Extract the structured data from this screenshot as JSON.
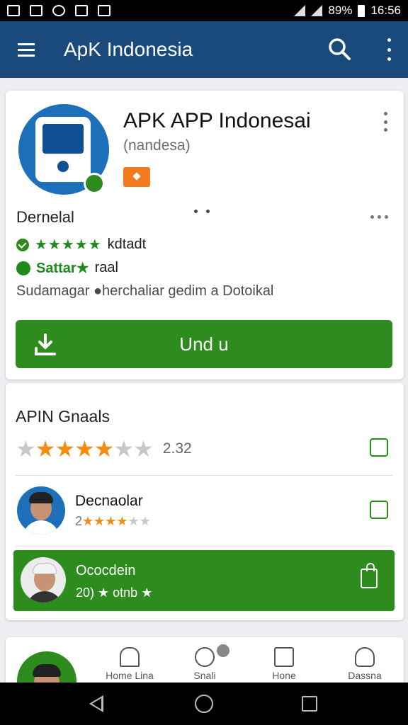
{
  "status_bar": {
    "battery": "89%",
    "time": "16:56"
  },
  "app_bar": {
    "title": "ApK Indonesia"
  },
  "app_card": {
    "name": "APK APP Indonesai",
    "subtitle": "(nandesa)",
    "section_title": "Dernelal",
    "line1_stars": "★★★★★",
    "line1_text": "kdtadt",
    "line2_green": "Sattar★",
    "line2_text": "raal",
    "description": "Sudamagar ●herchaliar gedim a Dotoikal",
    "install_label": "Und u"
  },
  "ratings_card": {
    "title": "APIN Gnaals",
    "stars_filled": "★★★★",
    "stars_empty": "★★",
    "rating_value": "2.32",
    "review1": {
      "name": "Decnaolar",
      "meta_prefix": "2",
      "stars_filled": "★★★★",
      "stars_empty": "★★"
    },
    "featured": {
      "name": "Ococdein",
      "meta": "20) ★ otnb ★"
    }
  },
  "bottom_nav": {
    "tab1": "Home Lina",
    "tab2": "Snali",
    "tab3": "Hone",
    "tab4": "Dassna"
  },
  "colors": {
    "appbar": "#1a4a7c",
    "accent_green": "#2e8b1e",
    "accent_orange": "#f28c14"
  }
}
